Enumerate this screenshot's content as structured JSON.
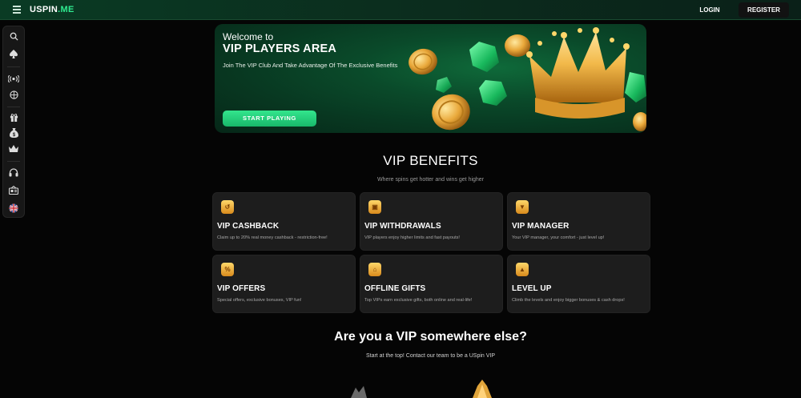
{
  "topbar": {
    "logo_main": "USPIN",
    "logo_dot": ".ME",
    "login_label": "LOGIN",
    "register_label": "REGISTER"
  },
  "sidebar": {
    "items": [
      {
        "icon": "search-icon",
        "glyph": "⌕"
      },
      {
        "icon": "spade-icon",
        "glyph": "♠"
      },
      {
        "icon": "live-icon",
        "glyph": "((•))"
      },
      {
        "icon": "basketball-icon",
        "glyph": "◍"
      },
      {
        "icon": "gift-icon",
        "glyph": "🎁"
      },
      {
        "icon": "money-bag-icon",
        "glyph": "$"
      },
      {
        "icon": "crown-icon",
        "glyph": "♛"
      },
      {
        "icon": "headset-icon",
        "glyph": "☊"
      },
      {
        "icon": "news-icon",
        "glyph": "▤"
      },
      {
        "icon": "uk-flag-icon",
        "glyph": "✚"
      }
    ]
  },
  "hero": {
    "welcome": "Welcome to",
    "title": "VIP PLAYERS AREA",
    "description": "Join The VIP Club And Take Advantage Of The Exclusive Benefits",
    "button_label": "START PLAYING"
  },
  "benefits": {
    "title": "VIP BENEFITS",
    "subtitle": "Where spins get hotter and wins get higher",
    "cards": [
      {
        "icon": "cashback-icon",
        "glyph": "↺",
        "title": "VIP CASHBACK",
        "desc": "Claim up to 20% real money cashback - restriction-free!"
      },
      {
        "icon": "withdrawal-icon",
        "glyph": "▣",
        "title": "VIP WITHDRAWALS",
        "desc": "VIP players enjoy higher limits and fast payouts!"
      },
      {
        "icon": "manager-icon",
        "glyph": "▼",
        "title": "VIP MANAGER",
        "desc": "Your VIP manager, your comfort - just level up!"
      },
      {
        "icon": "offers-icon",
        "glyph": "%",
        "title": "VIP OFFERS",
        "desc": "Special offers, exclusive bonuses, VIP fun!"
      },
      {
        "icon": "gift-box-icon",
        "glyph": "⌂",
        "title": "OFFLINE GIFTS",
        "desc": "Top VIPs earn exclusive gifts, both online and real-life!"
      },
      {
        "icon": "level-up-icon",
        "glyph": "▲",
        "title": "LEVEL UP",
        "desc": "Climb the levels and enjoy bigger bonuses & cash drops!"
      }
    ]
  },
  "vip_elsewhere": {
    "title": "Are you a VIP somewhere else?",
    "subtitle": "Start at the top! Contact our team to be a USpin VIP"
  },
  "colors": {
    "accent": "#2fe98f",
    "hero_bg": "#0a4a2a",
    "card_bg": "#1d1d1d",
    "gold": "#f0b33a"
  }
}
